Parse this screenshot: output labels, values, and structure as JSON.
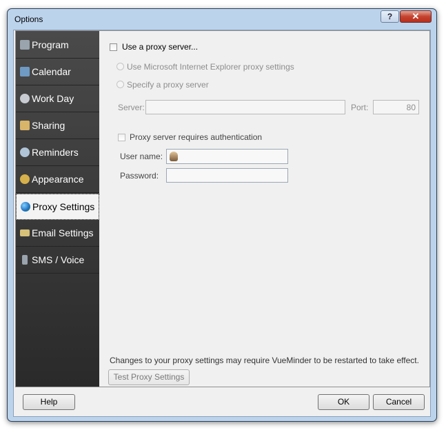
{
  "window": {
    "title": "Options",
    "help_glyph": "?",
    "close_glyph": "✕"
  },
  "sidebar": {
    "items": [
      {
        "label": "Program",
        "icon": "program-icon",
        "color": "#9aa4ad",
        "active": false
      },
      {
        "label": "Calendar",
        "icon": "calendar-icon",
        "color": "#6e9ac4",
        "active": false
      },
      {
        "label": "Work Day",
        "icon": "clock-icon",
        "color": "#c8ccd2",
        "active": false
      },
      {
        "label": "Sharing",
        "icon": "sharing-icon",
        "color": "#d9b56a",
        "active": false
      },
      {
        "label": "Reminders",
        "icon": "reminders-icon",
        "color": "#b0c4d8",
        "active": false
      },
      {
        "label": "Appearance",
        "icon": "appearance-icon",
        "color": "#d6b04a",
        "active": false
      },
      {
        "label": "Proxy Settings",
        "icon": "globe-icon",
        "color": "#3a8ad6",
        "active": true
      },
      {
        "label": "Email Settings",
        "icon": "email-icon",
        "color": "#d8c27a",
        "active": false
      },
      {
        "label": "SMS / Voice",
        "icon": "phone-icon",
        "color": "#9aa4ad",
        "active": false
      }
    ]
  },
  "proxy": {
    "use_proxy_label": "Use a proxy server...",
    "ie_settings_label": "Use Microsoft Internet Explorer proxy settings",
    "specify_label": "Specify a proxy server",
    "server_label": "Server:",
    "server_value": "",
    "port_label": "Port:",
    "port_value": "80",
    "auth_label": "Proxy server requires authentication",
    "username_label": "User name:",
    "username_value": "",
    "password_label": "Password:",
    "password_value": "",
    "note": "Changes to your proxy settings may require VueMinder to be restarted to take effect.",
    "test_button": "Test Proxy Settings"
  },
  "footer": {
    "help_button": "Help",
    "ok_button": "OK",
    "cancel_button": "Cancel"
  }
}
